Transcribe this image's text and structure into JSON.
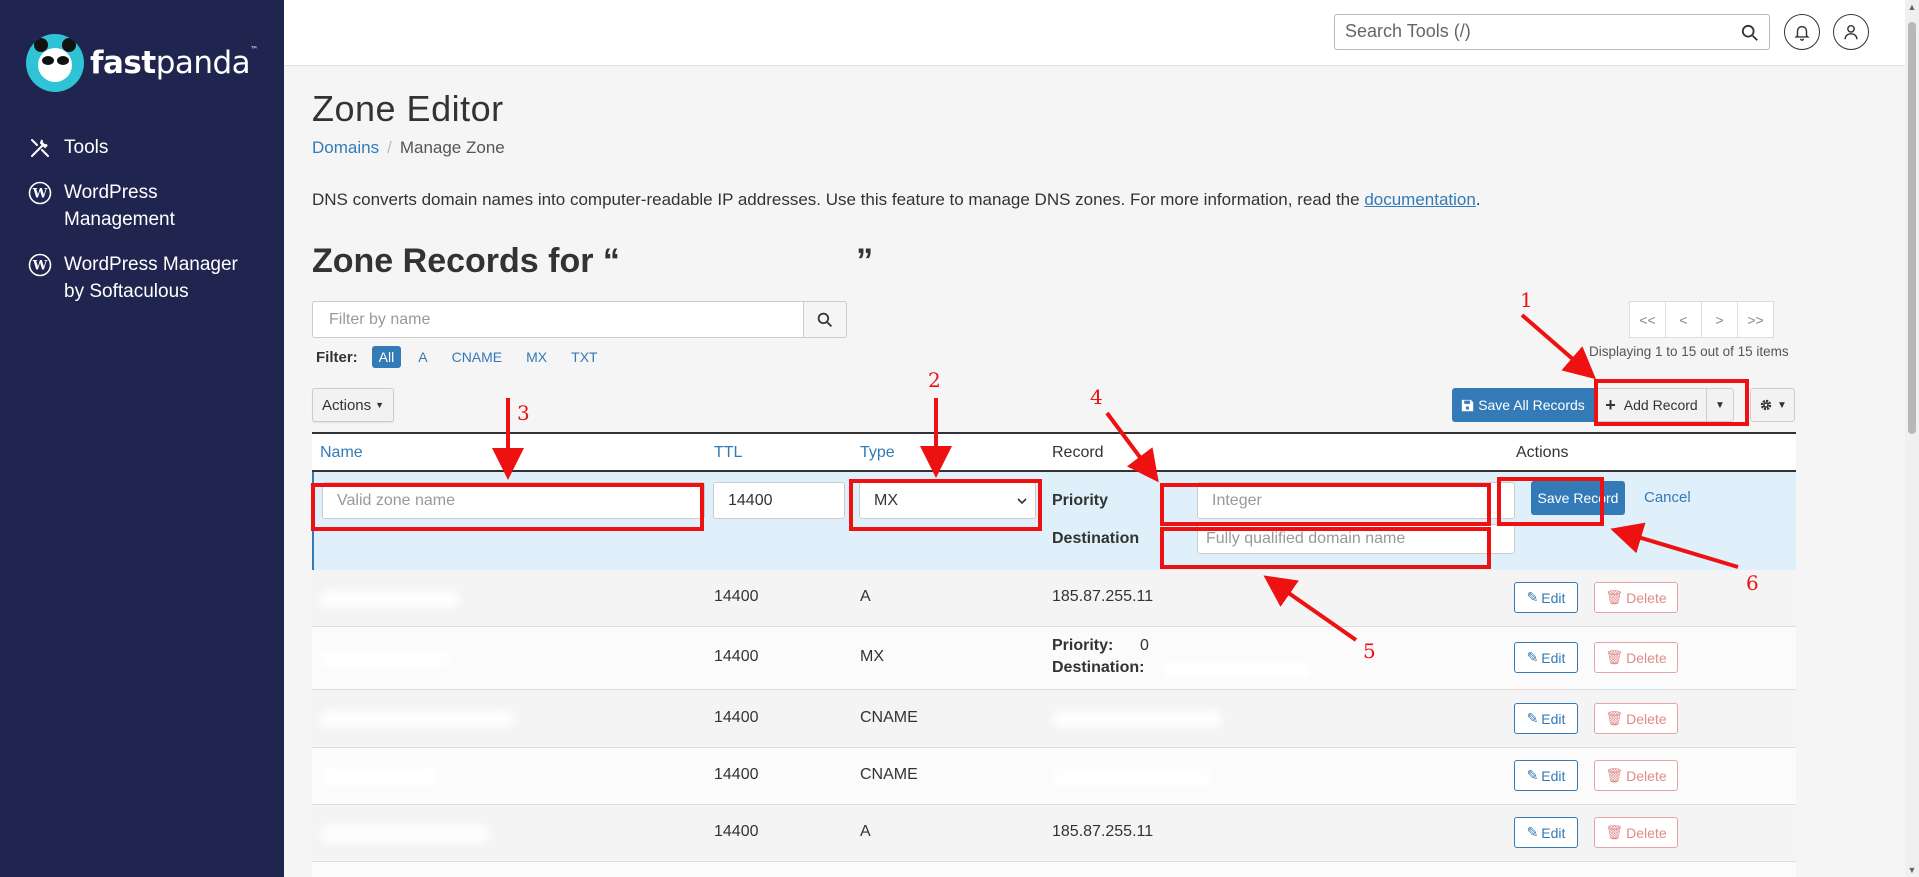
{
  "sidebar": {
    "logo_text_bold": "fast",
    "logo_text_light": "panda",
    "logo_tm": "™",
    "items": [
      {
        "label": "Tools"
      },
      {
        "label_line1": "WordPress",
        "label_line2": "Management"
      },
      {
        "label_line1": "WordPress Manager",
        "label_line2": "by Softaculous"
      }
    ]
  },
  "topbar": {
    "search_placeholder": "Search Tools (/)"
  },
  "page": {
    "title": "Zone Editor",
    "breadcrumb": {
      "parent": "Domains",
      "current": "Manage Zone"
    },
    "description": "DNS converts domain names into computer-readable IP addresses. Use this feature to manage DNS zones. For more information, read the ",
    "description_link": "documentation",
    "description_end": ".",
    "zone_title": "Zone Records for “                         ”"
  },
  "toolbar": {
    "filter_placeholder": "Filter by name",
    "filter_label": "Filter:",
    "filter_pills": [
      "All",
      "A",
      "CNAME",
      "MX",
      "TXT"
    ],
    "pager": [
      "<<",
      "<",
      ">",
      ">>"
    ],
    "displaying": "Displaying 1 to 15 out of 15 items",
    "actions_label": "Actions",
    "save_all_label": "Save All Records",
    "add_record_label": "Add Record"
  },
  "table": {
    "headers": {
      "name": "Name",
      "ttl": "TTL",
      "type": "Type",
      "record": "Record",
      "actions": "Actions"
    },
    "edit_row": {
      "name_placeholder": "Valid zone name",
      "ttl_value": "14400",
      "type_value": "MX",
      "priority_label": "Priority",
      "priority_placeholder": "Integer",
      "destination_label": "Destination",
      "destination_placeholder": "Fully qualified domain name",
      "save_label": "Save Record",
      "cancel_label": "Cancel"
    },
    "rows": [
      {
        "ttl": "14400",
        "type": "A",
        "record": "185.87.255.11"
      },
      {
        "ttl": "14400",
        "type": "MX",
        "priority_label": "Priority:",
        "priority_value": "0",
        "destination_label": "Destination:"
      },
      {
        "ttl": "14400",
        "type": "CNAME",
        "record": ""
      },
      {
        "ttl": "14400",
        "type": "CNAME",
        "record": ""
      },
      {
        "ttl": "14400",
        "type": "A",
        "record": "185.87.255.11"
      }
    ],
    "edit_label": "Edit",
    "delete_label": "Delete"
  },
  "annotations": [
    "1",
    "2",
    "3",
    "4",
    "5",
    "6"
  ],
  "colors": {
    "sidebar": "#20254f",
    "accent": "#337ab7",
    "annotation": "#ee1111",
    "edit_row": "#dff0fb",
    "logo": "#2ec4d6"
  }
}
